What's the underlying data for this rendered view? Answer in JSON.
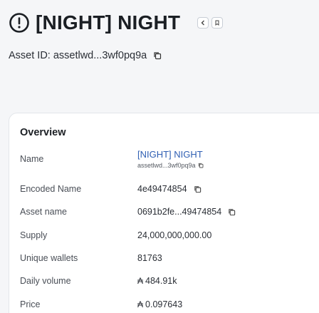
{
  "header": {
    "title": "[NIGHT] NIGHT",
    "clock_icon": "clock-icon",
    "mini_buttons": [
      "chevron-left-icon",
      "bookmark-icon"
    ]
  },
  "asset_id": {
    "label": "Asset ID:",
    "value": "assetlwd...3wf0pq9a",
    "copy_icon": "copy-icon"
  },
  "overview": {
    "title": "Overview",
    "name_label": "Name",
    "name_value": "[NIGHT] NIGHT",
    "name_sub": "assetlwd...3wf0pq9a",
    "encoded_name_label": "Encoded Name",
    "encoded_name_value": "4e49474854",
    "asset_name_label": "Asset name",
    "asset_name_value": "0691b2fe...49474854",
    "supply_label": "Supply",
    "supply_value": "24,000,000,000.00",
    "unique_wallets_label": "Unique wallets",
    "unique_wallets_value": "81763",
    "daily_volume_label": "Daily volume",
    "daily_volume_value": "484.91k",
    "price_label": "Price",
    "price_value": "0.097643",
    "currency_symbol": "₳"
  }
}
